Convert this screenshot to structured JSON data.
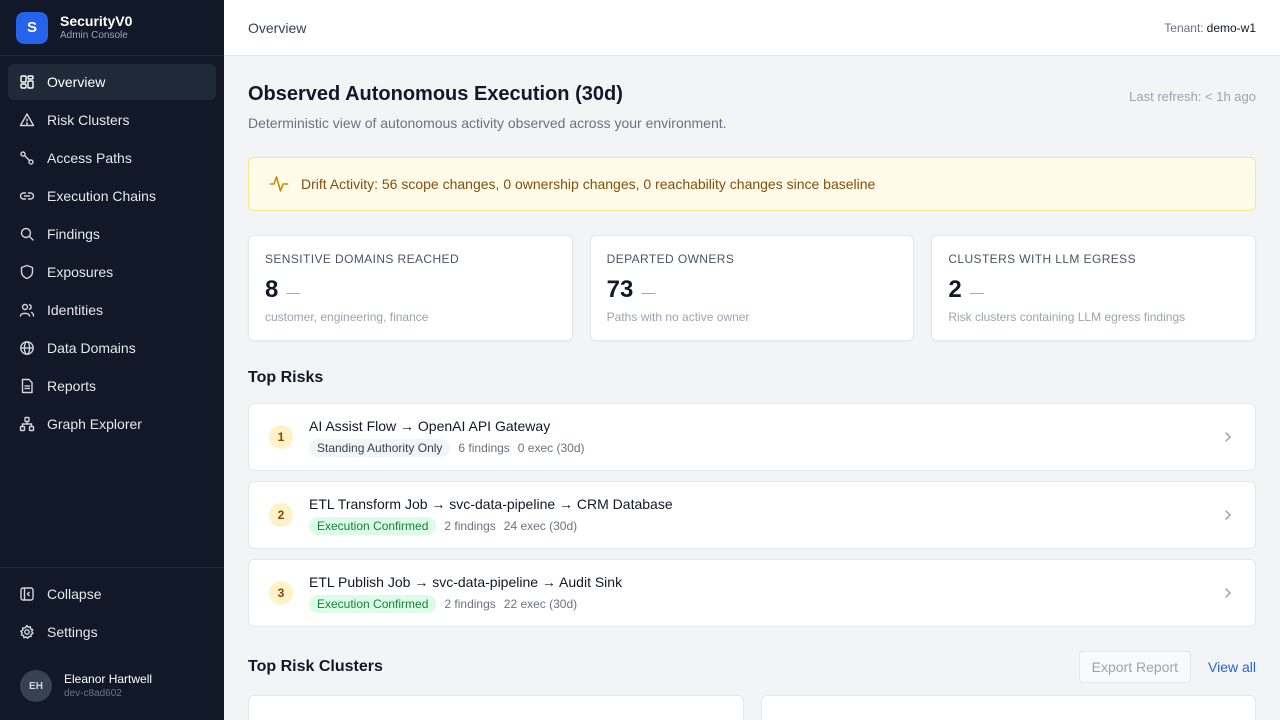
{
  "brand": {
    "logo_letter": "S",
    "name": "SecurityV0",
    "subtitle": "Admin Console"
  },
  "sidebar": {
    "items": [
      {
        "label": "Overview",
        "icon": "dashboard-icon",
        "active": true
      },
      {
        "label": "Risk Clusters",
        "icon": "warning-triangle-icon"
      },
      {
        "label": "Access Paths",
        "icon": "route-icon"
      },
      {
        "label": "Execution Chains",
        "icon": "link-icon"
      },
      {
        "label": "Findings",
        "icon": "search-icon"
      },
      {
        "label": "Exposures",
        "icon": "shield-icon"
      },
      {
        "label": "Identities",
        "icon": "users-icon"
      },
      {
        "label": "Data Domains",
        "icon": "globe-icon"
      },
      {
        "label": "Reports",
        "icon": "file-text-icon"
      },
      {
        "label": "Graph Explorer",
        "icon": "graph-icon"
      }
    ],
    "collapse_label": "Collapse",
    "settings_label": "Settings",
    "user": {
      "initials": "EH",
      "name": "Eleanor Hartwell",
      "id": "dev-c8ad602"
    }
  },
  "header": {
    "breadcrumb": "Overview",
    "tenant_label": "Tenant:",
    "tenant_value": "demo-w1"
  },
  "page": {
    "title": "Observed Autonomous Execution (30d)",
    "subtitle": "Deterministic view of autonomous activity observed across your environment.",
    "last_refresh": "Last refresh: < 1h ago"
  },
  "drift": {
    "text": "Drift Activity: 56 scope changes, 0 ownership changes, 0 reachability changes since baseline",
    "accent": "#ca8a04"
  },
  "stats": [
    {
      "label": "Sensitive Domains Reached",
      "value": "8",
      "delta": "—",
      "desc": "customer, engineering, finance"
    },
    {
      "label": "Departed Owners",
      "value": "73",
      "delta": "—",
      "desc": "Paths with no active owner"
    },
    {
      "label": "Clusters With LLM Egress",
      "value": "2",
      "delta": "—",
      "desc": "Risk clusters containing LLM egress findings"
    }
  ],
  "top_risks": {
    "title": "Top Risks",
    "items": [
      {
        "rank": "1",
        "title": "AI Assist Flow → OpenAI API Gateway",
        "badge": "Standing Authority Only",
        "findings": "6 findings",
        "exec": "0 exec (30d)"
      },
      {
        "rank": "2",
        "title": "ETL Transform Job → svc-data-pipeline → CRM Database",
        "badge": "Execution Confirmed",
        "findings": "2 findings",
        "exec": "24 exec (30d)"
      },
      {
        "rank": "3",
        "title": "ETL Publish Job → svc-data-pipeline → Audit Sink",
        "badge": "Execution Confirmed",
        "findings": "2 findings",
        "exec": "22 exec (30d)"
      }
    ]
  },
  "clusters": {
    "title": "Top Risk Clusters",
    "export_label": "Export Report",
    "view_all_label": "View all"
  },
  "colors": {
    "sidebar_bg": "#111827",
    "accent": "#2563eb",
    "drift_bg": "#fefce8",
    "badge_green": "#dcfce7"
  }
}
